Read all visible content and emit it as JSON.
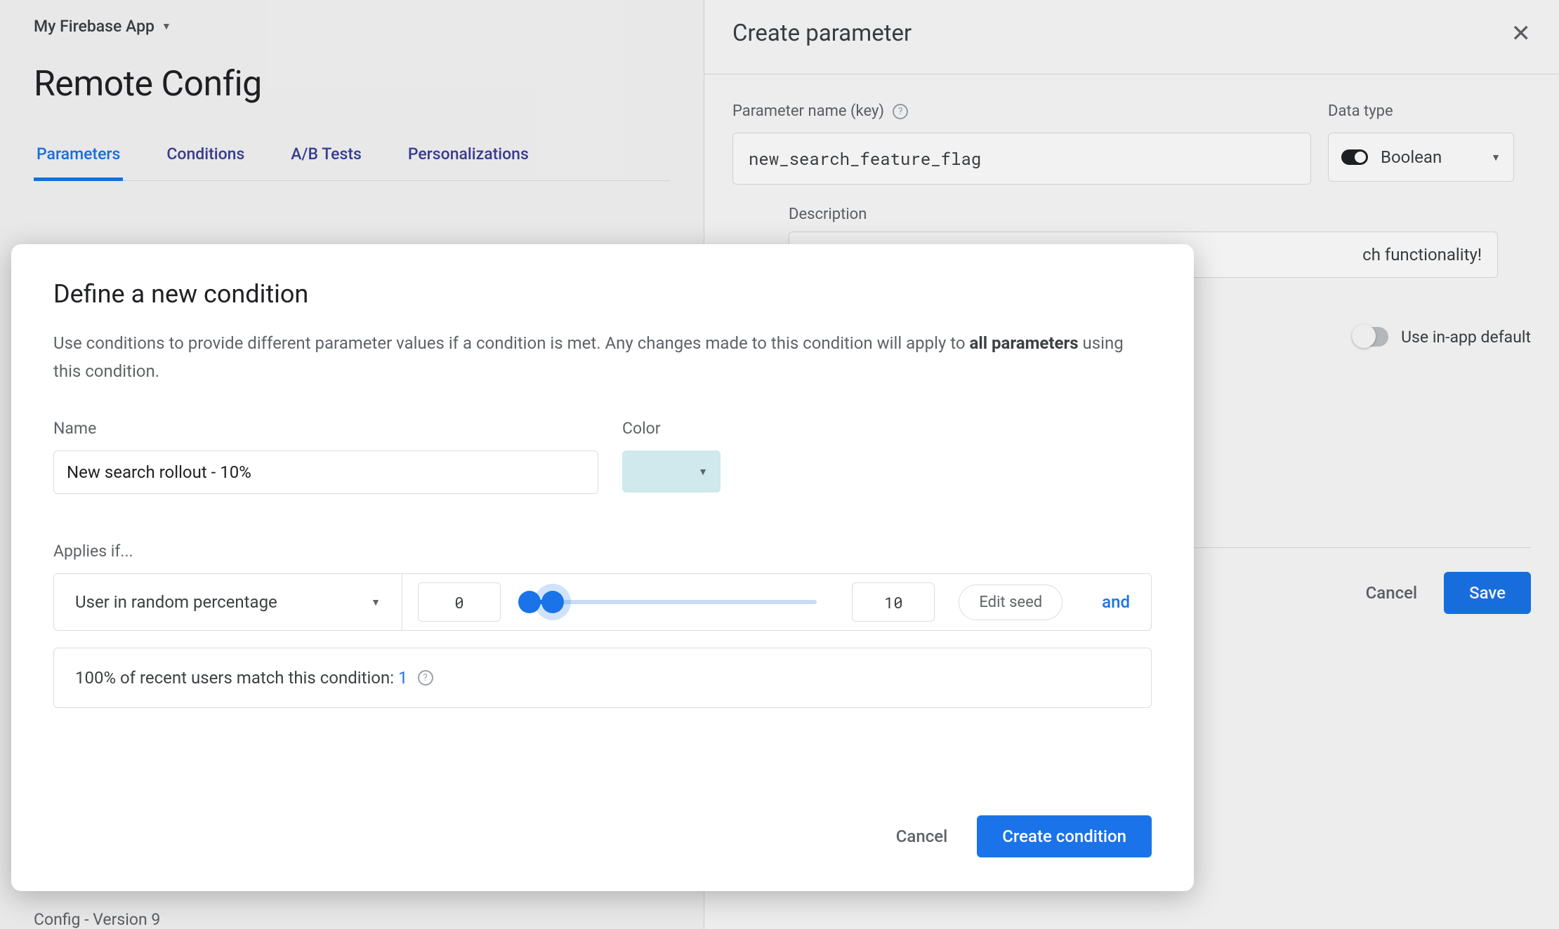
{
  "header": {
    "app_name": "My Firebase App",
    "page_title": "Remote Config"
  },
  "tabs": {
    "parameters": "Parameters",
    "conditions": "Conditions",
    "abtests": "A/B Tests",
    "personalizations": "Personalizations"
  },
  "footer": {
    "config_version": "Config - Version 9"
  },
  "panel": {
    "title": "Create parameter",
    "param_key_label": "Parameter name (key)",
    "param_key_value": "new_search_feature_flag",
    "datatype_label": "Data type",
    "datatype_value": "Boolean",
    "description_label": "Description",
    "description_value": "ch functionality!",
    "use_inapp_default_label": "Use in-app default",
    "cancel": "Cancel",
    "save": "Save"
  },
  "dialog": {
    "title": "Define a new condition",
    "desc_a": "Use conditions to provide different parameter values if a condition is met. Any changes made to this condition will apply to ",
    "desc_bold": "all parameters",
    "desc_b": " using this condition.",
    "name_label": "Name",
    "name_value": "New search rollout - 10%",
    "color_label": "Color",
    "color_value": "#cfe9ec",
    "applies_if": "Applies if...",
    "rule_type": "User in random percentage",
    "min_value": "0",
    "max_value": "10",
    "edit_seed": "Edit seed",
    "and": "and",
    "match_text": "100% of recent users match this condition: ",
    "match_count": "1",
    "cancel": "Cancel",
    "create": "Create condition"
  }
}
